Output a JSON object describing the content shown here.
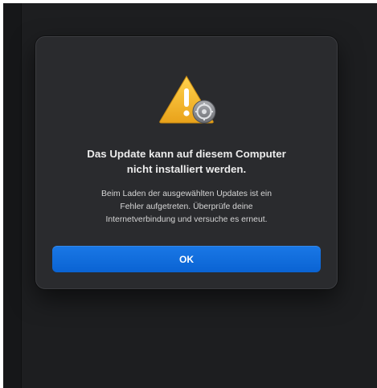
{
  "dialog": {
    "icon": "warning-triangle-icon",
    "badge_icon": "software-update-gear-icon",
    "title_lines": [
      "Das Update kann auf diesem Computer",
      "nicht installiert werden."
    ],
    "message_lines": [
      "Beim Laden der ausgewählten Updates ist ein",
      "Fehler aufgetreten. Überprüfe deine",
      "Internetverbindung und versuche es erneut."
    ],
    "ok_label": "OK"
  },
  "colors": {
    "accent": "#0a6ad9",
    "dialog_background": "#2a2b2e",
    "window_background": "#1d1e20",
    "warning": "#f5b82e"
  }
}
